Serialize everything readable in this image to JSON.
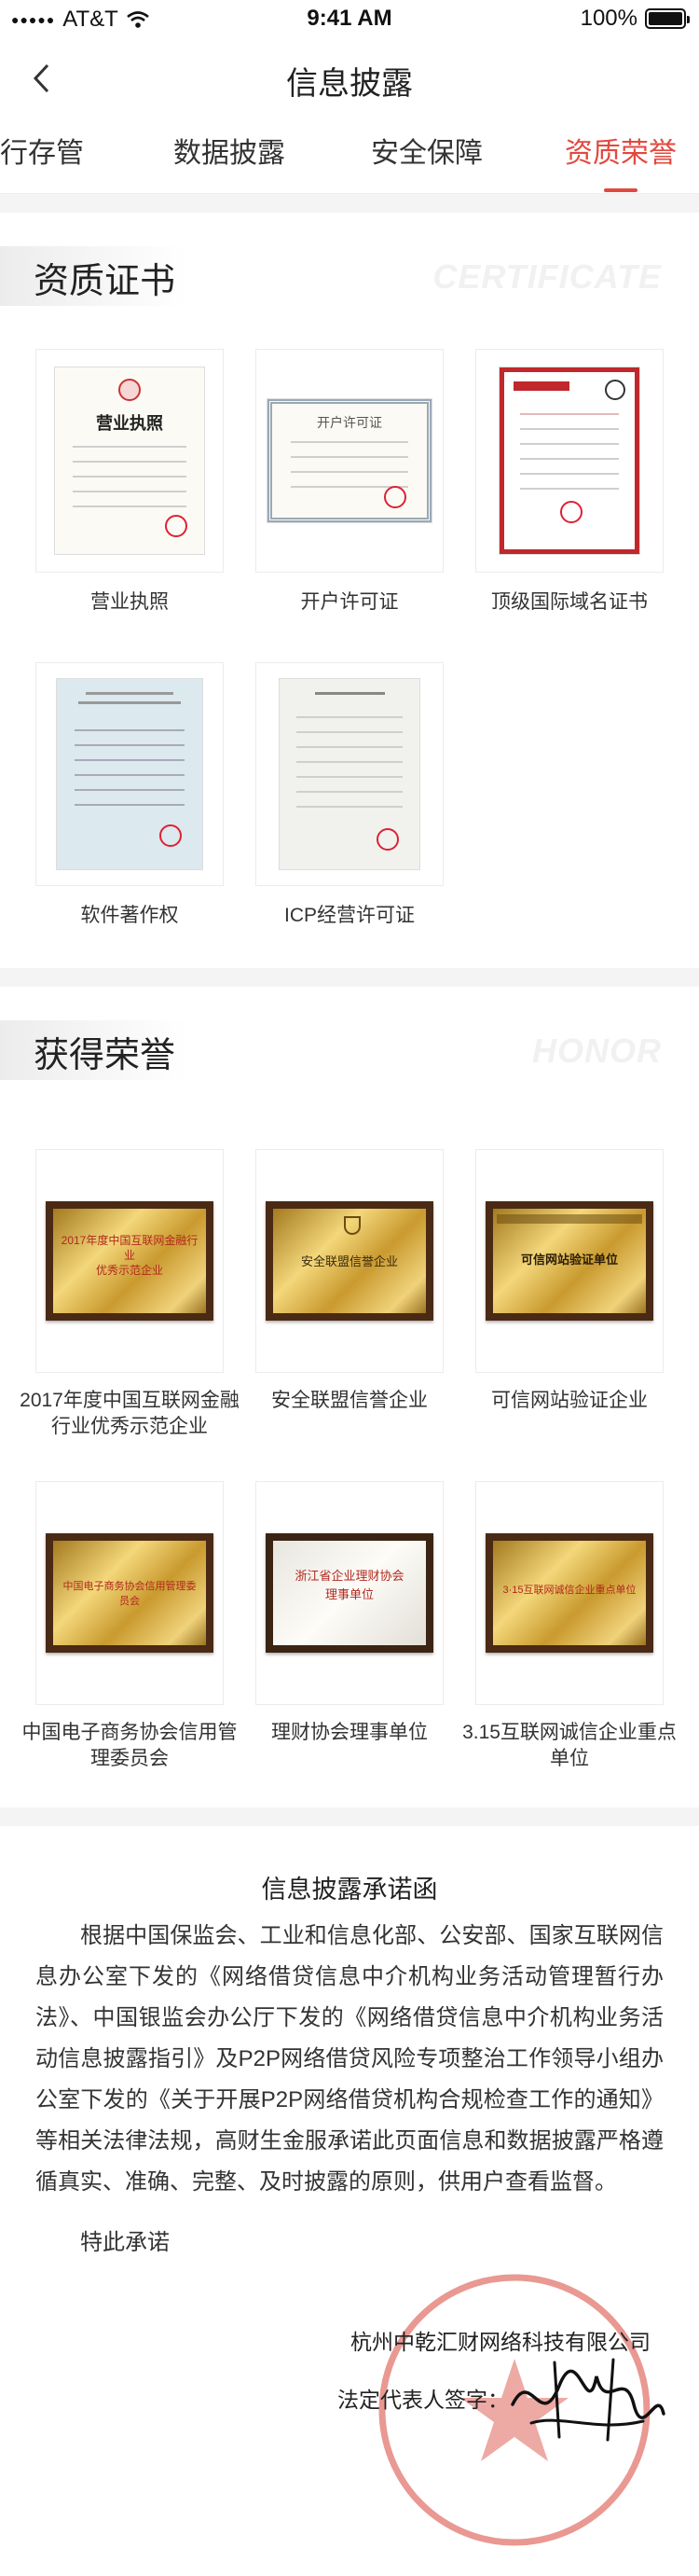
{
  "status_bar": {
    "carrier": "AT&T",
    "time": "9:41 AM",
    "battery_text": "100%",
    "battery_level": 1.0
  },
  "nav": {
    "title": "信息披露",
    "back_icon": "chevron-left-icon"
  },
  "tabs": [
    {
      "label": "行存管",
      "active": false
    },
    {
      "label": "数据披露",
      "active": false
    },
    {
      "label": "安全保障",
      "active": false
    },
    {
      "label": "资质荣誉",
      "active": true
    }
  ],
  "certificates": {
    "title": "资质证书",
    "watermark": "CERTIFICATE",
    "items": [
      {
        "label": "营业执照",
        "doc_title": "营业执照"
      },
      {
        "label": "开户许可证",
        "doc_title": "开户许可证"
      },
      {
        "label": "顶级国际域名证书",
        "doc_title": ""
      },
      {
        "label": "软件著作权",
        "doc_title": ""
      },
      {
        "label": "ICP经营许可证",
        "doc_title": ""
      }
    ]
  },
  "honors": {
    "title": "获得荣誉",
    "watermark": "HONOR",
    "items": [
      {
        "label": "2017年度中国互联网金融行业优秀示范企业",
        "plaque_text": "2017年度中国互联网金融行业\n优秀示范企业"
      },
      {
        "label": "安全联盟信誉企业",
        "plaque_text": "安全联盟信誉企业"
      },
      {
        "label": "可信网站验证企业",
        "plaque_text": "可信网站验证单位"
      },
      {
        "label": "中国电子商务协会信用管理委员会",
        "plaque_text": "中国电子商务协会信用管理委员会"
      },
      {
        "label": "理财协会理事单位",
        "plaque_text": "浙江省企业理财协会\n理事单位"
      },
      {
        "label": "3.15互联网诚信企业重点单位",
        "plaque_text": "3·15互联网诚信企业重点单位"
      }
    ]
  },
  "pledge": {
    "title": "信息披露承诺函",
    "body": "根据中国保监会、工业和信息化部、公安部、国家互联网信息办公室下发的《网络借贷信息中介机构业务活动管理暂行办法》、中国银监会办公厅下发的《网络借贷信息中介机构业务活动信息披露指引》及P2P网络借贷风险专项整治工作领导小组办公室下发的《关于开展P2P网络借贷机构合规检查工作的通知》等相关法律法规，高财生金服承诺此页面信息和数据披露严格遵循真实、准确、完整、及时披露的原则，供用户查看监督。",
    "closing": "特此承诺",
    "company": "杭州中乾汇财网络科技有限公司",
    "rep_label": "法定代表人签字："
  },
  "colors": {
    "accent": "#e2493e",
    "gold": "#e8c25a",
    "frame": "#4a2a14"
  }
}
